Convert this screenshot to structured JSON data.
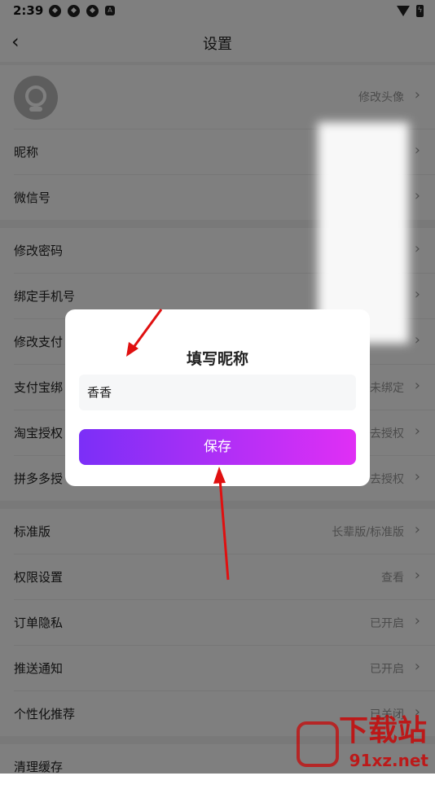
{
  "status": {
    "time": "2:39",
    "badge": "A"
  },
  "nav": {
    "back": "‹",
    "title": "设置"
  },
  "sections": {
    "profile": [
      {
        "label": "",
        "value": "修改头像"
      },
      {
        "label": "昵称",
        "value": ""
      },
      {
        "label": "微信号",
        "value": ""
      }
    ],
    "account": [
      {
        "label": "修改密码",
        "value": ""
      },
      {
        "label": "绑定手机号",
        "value": ""
      },
      {
        "label": "修改支付",
        "value": ""
      },
      {
        "label": "支付宝绑",
        "value": "未绑定"
      },
      {
        "label": "淘宝授权",
        "value": "去授权"
      },
      {
        "label": "拼多多授",
        "value": "去授权"
      }
    ],
    "prefs": [
      {
        "label": "标准版",
        "value": "长辈版/标准版"
      },
      {
        "label": "权限设置",
        "value": "查看"
      },
      {
        "label": "订单隐私",
        "value": "已开启"
      },
      {
        "label": "推送通知",
        "value": "已开启"
      },
      {
        "label": "个性化推荐",
        "value": "已关闭"
      }
    ],
    "misc": [
      {
        "label": "清理缓存",
        "value": ""
      }
    ]
  },
  "chevron": "›",
  "dialog": {
    "title": "填写昵称",
    "input_value": "香香",
    "save_label": "保存"
  },
  "watermark": {
    "line1": "下载站",
    "line2": "91xz.net",
    "logo": "9"
  },
  "colors": {
    "button_start": "#7b2ff7",
    "button_end": "#e02ff5",
    "annotation": "#e01010"
  }
}
